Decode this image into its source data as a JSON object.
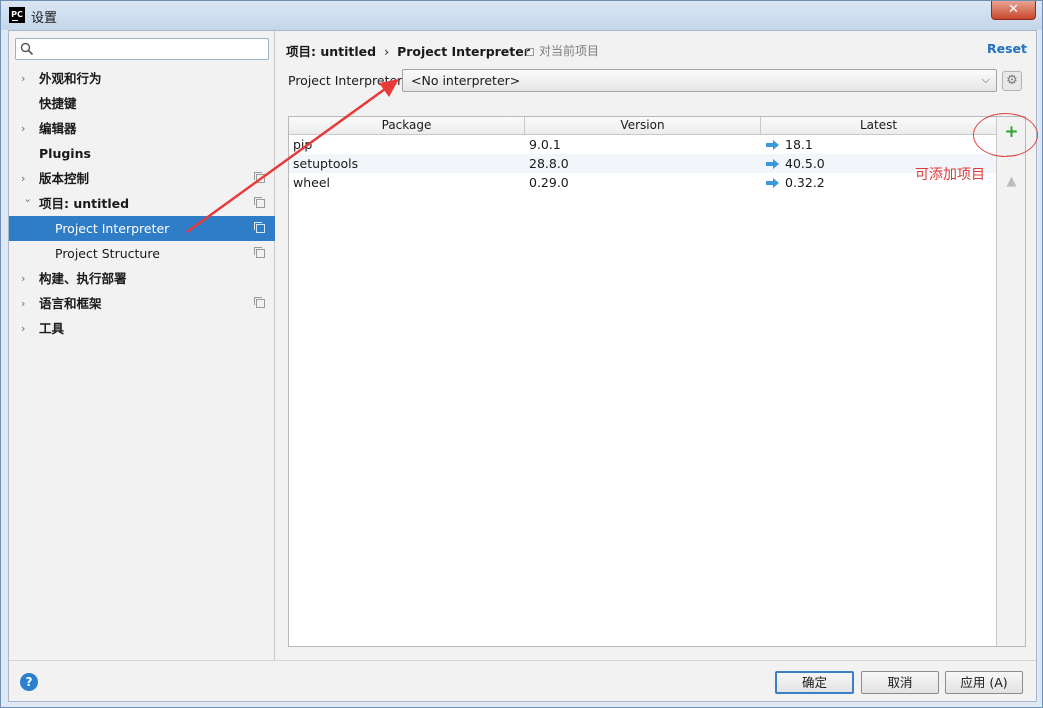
{
  "window": {
    "title": "设置",
    "app_icon": "PC",
    "close_label": "✕"
  },
  "sidebar": {
    "search": {
      "value": "",
      "placeholder": ""
    },
    "items": [
      {
        "label": "外观和行为",
        "expandable": true,
        "bold": true
      },
      {
        "label": "快捷键",
        "expandable": false,
        "bold": true
      },
      {
        "label": "编辑器",
        "expandable": true,
        "bold": true
      },
      {
        "label": "Plugins",
        "expandable": false,
        "bold": true
      },
      {
        "label": "版本控制",
        "expandable": true,
        "bold": true
      },
      {
        "label": "项目: untitled",
        "expandable": true,
        "expanded": true,
        "bold": true
      },
      {
        "label": "Project Interpreter",
        "selected": true
      },
      {
        "label": "Project Structure"
      },
      {
        "label": "构建、执行部署",
        "expandable": true,
        "bold": true
      },
      {
        "label": "语言和框架",
        "expandable": true,
        "bold": true
      },
      {
        "label": "工具",
        "expandable": true,
        "bold": true
      }
    ]
  },
  "breadcrumb": {
    "project": "项目: untitled",
    "separator": "›",
    "page": "Project Interpreter",
    "scope": "对当前项目"
  },
  "reset_label": "Reset",
  "interpreter": {
    "label": "Project Interpreter:",
    "value": "<No interpreter>"
  },
  "packages": {
    "columns": [
      "Package",
      "Version",
      "Latest"
    ],
    "rows": [
      {
        "package": "pip",
        "version": "9.0.1",
        "latest": "18.1"
      },
      {
        "package": "setuptools",
        "version": "28.8.0",
        "latest": "40.5.0"
      },
      {
        "package": "wheel",
        "version": "0.29.0",
        "latest": "0.32.2"
      }
    ]
  },
  "annotation": {
    "text": "可添加项目",
    "color": "#e03a3a"
  },
  "buttons": {
    "help": "?",
    "ok": "确定",
    "cancel": "取消",
    "apply": "应用 (A)"
  },
  "colors": {
    "selection": "#2f7dc7",
    "link": "#2070c0",
    "add": "#2ea32e",
    "upgrade_arrow": "#3a9ad9"
  }
}
